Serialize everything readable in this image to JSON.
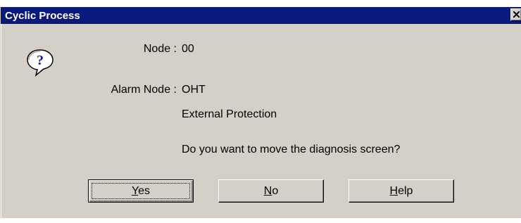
{
  "window": {
    "title": "Cyclic Process"
  },
  "icons": {
    "dialog_icon": "question-icon",
    "close": "close-icon"
  },
  "fields": [
    {
      "label": "Node :",
      "value": "00"
    },
    {
      "label": "Alarm Node :",
      "value": "OHT"
    }
  ],
  "message": {
    "detail": "External Protection",
    "question": "Do you want to move the diagnosis screen?"
  },
  "buttons": {
    "yes": {
      "mnemonic": "Y",
      "rest": "es"
    },
    "no": {
      "mnemonic": "N",
      "rest": "o"
    },
    "help": {
      "mnemonic": "H",
      "rest": "elp"
    }
  },
  "colors": {
    "titlebar": "#0a1a7a",
    "dialog_bg": "#d4d0c8"
  }
}
